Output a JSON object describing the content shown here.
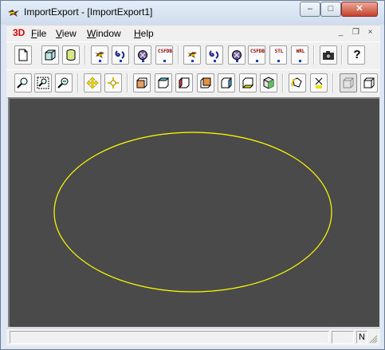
{
  "window": {
    "title": "ImportExport - [ImportExport1]",
    "controls": {
      "minimize": "–",
      "maximize": "□",
      "close": "✕"
    }
  },
  "menubar": {
    "logo": "3D",
    "items": [
      {
        "label": "File",
        "mnemonic": "F",
        "rest": "ile"
      },
      {
        "label": "View",
        "mnemonic": "V",
        "rest": "iew"
      },
      {
        "label": "Window",
        "mnemonic": "W",
        "rest": "indow"
      },
      {
        "label": "Help",
        "mnemonic": "H",
        "rest": "elp"
      }
    ],
    "mdi_controls": {
      "minimize": "_",
      "restore": "❐",
      "close": "×"
    }
  },
  "toolbar1": {
    "labels": {
      "csfdb": "CSFDB",
      "stl": "STL",
      "wrl": "WRL",
      "csfdb2": "CSFDB",
      "help": "?"
    }
  },
  "viewport": {
    "background": "#4a4a4a",
    "shape_color": "#ffff00"
  },
  "statusbar": {
    "pane_text": "N"
  }
}
